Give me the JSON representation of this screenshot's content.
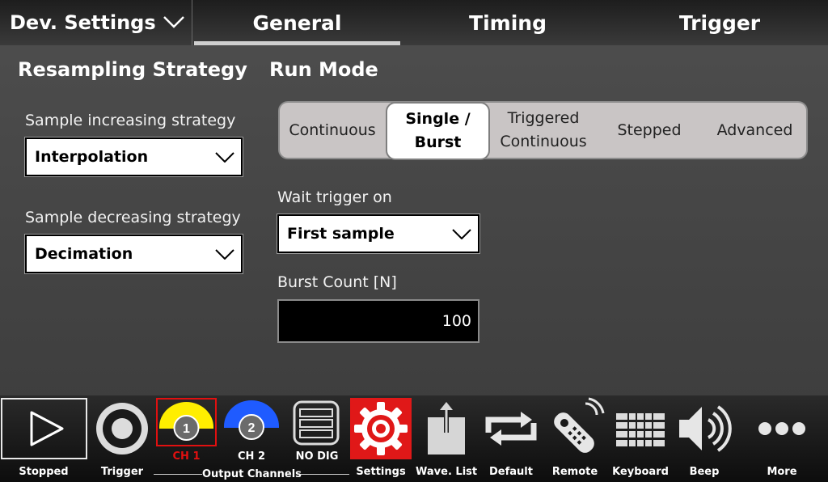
{
  "header": {
    "menu_label": "Dev. Settings",
    "tabs": [
      {
        "label": "General",
        "selected": true
      },
      {
        "label": "Timing",
        "selected": false
      },
      {
        "label": "Trigger",
        "selected": false
      }
    ]
  },
  "resampling": {
    "title": "Resampling Strategy",
    "increasing_label": "Sample increasing strategy",
    "increasing_value": "Interpolation",
    "decreasing_label": "Sample decreasing strategy",
    "decreasing_value": "Decimation"
  },
  "run_mode": {
    "title": "Run Mode",
    "options": [
      {
        "line1": "Continuous",
        "line2": ""
      },
      {
        "line1": "Single /",
        "line2": "Burst"
      },
      {
        "line1": "Triggered",
        "line2": "Continuous"
      },
      {
        "line1": "Stepped",
        "line2": ""
      },
      {
        "line1": "Advanced",
        "line2": ""
      }
    ],
    "selected": "Single / Burst",
    "wait_trigger_label": "Wait trigger on",
    "wait_trigger_value": "First sample",
    "burst_count_label": "Burst Count [N]",
    "burst_count_value": "100"
  },
  "toolbar": {
    "stopped": "Stopped",
    "trigger": "Trigger",
    "ch1_number": "1",
    "ch1_label": "CH 1",
    "ch2_number": "2",
    "ch2_label": "CH 2",
    "no_dig": "NO DIG",
    "output_channels": "Output Channels",
    "settings": "Settings",
    "wave_list": "Wave. List",
    "default": "Default",
    "remote": "Remote",
    "keyboard": "Keyboard",
    "beep": "Beep",
    "more": "More"
  },
  "colors": {
    "ch1": "#ffee00",
    "ch2": "#1f5bff",
    "selected_red": "#e01818"
  }
}
